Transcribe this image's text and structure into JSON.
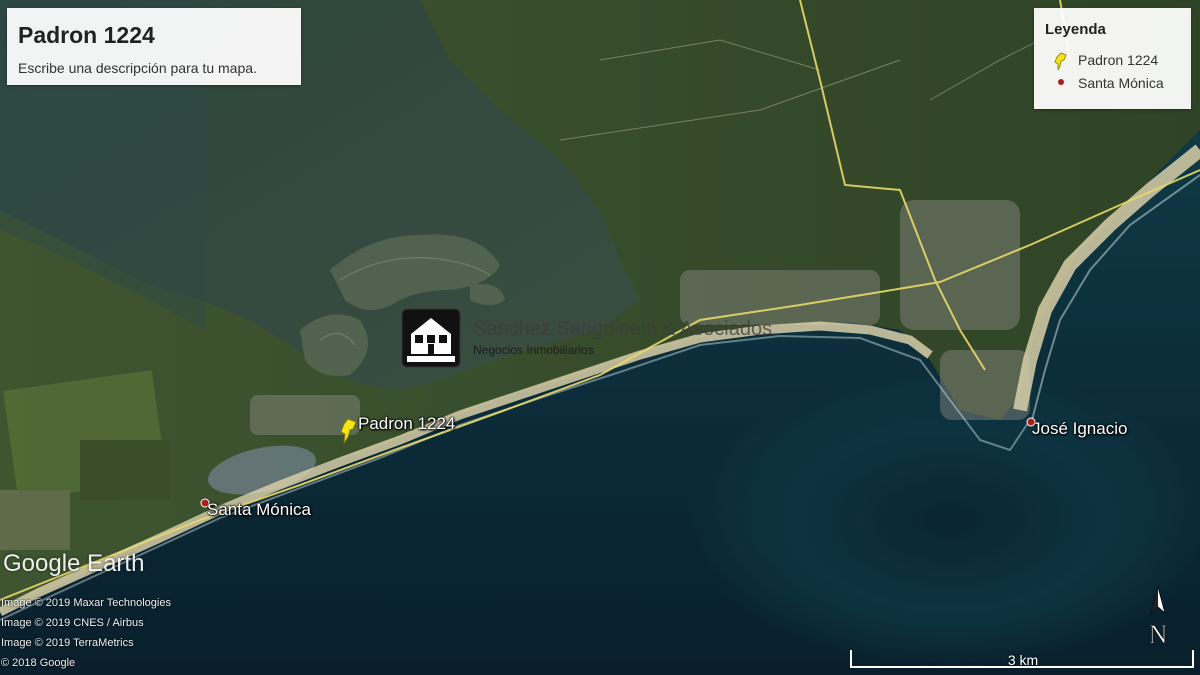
{
  "title_panel": {
    "title": "Padron 1224",
    "description": "Escribe una descripción para tu mapa."
  },
  "legend": {
    "heading": "Leyenda",
    "items": [
      {
        "label": "Padron 1224",
        "icon": "yellow-pushpin-icon",
        "color": "#f5e61a"
      },
      {
        "label": "Santa Mónica",
        "icon": "red-dot-icon",
        "color": "#b01c1c"
      }
    ]
  },
  "places": [
    {
      "name": "Padron 1224",
      "icon": "yellow-pushpin-icon"
    },
    {
      "name": "Santa Mónica",
      "icon": "red-dot-icon"
    },
    {
      "name": "José Ignacio",
      "icon": "red-dot-icon"
    }
  ],
  "watermark": {
    "name": "Sanchez Sanguinetti & Asociados",
    "subtitle": "Negocios Inmobiliarios"
  },
  "brand": "Google Earth",
  "credits": [
    "Image © 2019 Maxar Technologies",
    "Image © 2019 CNES / Airbus",
    "Image © 2019 TerraMetrics",
    "© 2018 Google"
  ],
  "scale": {
    "label": "3 km"
  },
  "compass": {
    "label": "N"
  },
  "colors": {
    "ocean": "#0f3440",
    "land": "#3a4a2e",
    "beach": "#d8cfa8",
    "road": "#e8d96a"
  }
}
